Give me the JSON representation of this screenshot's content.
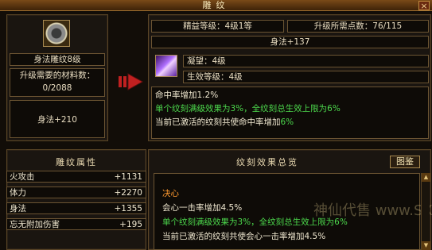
{
  "window": {
    "title": "雕纹",
    "close_label": "×"
  },
  "left_top": {
    "item_name": "身法雕纹8级",
    "materials_label": "升级需要的材料数：",
    "materials_value": "0/2088",
    "stat": "身法+210"
  },
  "right_top": {
    "refine_level": "精益等级：4级1等",
    "points_needed": "升级所需点数：76/115",
    "stat": "身法+137",
    "condense_label": "凝望：4级",
    "effect_level": "生效等级：4级",
    "desc": [
      {
        "text": "命中率增加1.2%",
        "color": "white"
      },
      {
        "text": "单个纹刻满级效果为3%，全纹刻总生效上限为6%",
        "color": "green"
      },
      {
        "text": "当前已激活的纹刻共使命中率增加6%",
        "color": "white",
        "suffix": "6%"
      }
    ]
  },
  "attributes": {
    "title": "雕纹属性",
    "rows": [
      {
        "name": "火攻击",
        "value": "+1131"
      },
      {
        "name": "体力",
        "value": "+2270"
      },
      {
        "name": "身法",
        "value": "+1355"
      },
      {
        "name": "忘无附加伤害",
        "value": "+195"
      }
    ]
  },
  "effects": {
    "title": "纹刻效果总览",
    "button_label": "图鉴",
    "heading": "决心",
    "lines": [
      {
        "text": "会心一击率增加4.5%",
        "color": "white"
      },
      {
        "text": "单个纹刻满级效果为3%，全纹刻总生效上限为6%",
        "color": "green"
      },
      {
        "text": "当前已激活的纹刻共使会心一击率增加4.5%",
        "color": "white"
      }
    ],
    "watermark": "神仙代售 www.SXDS.com"
  }
}
